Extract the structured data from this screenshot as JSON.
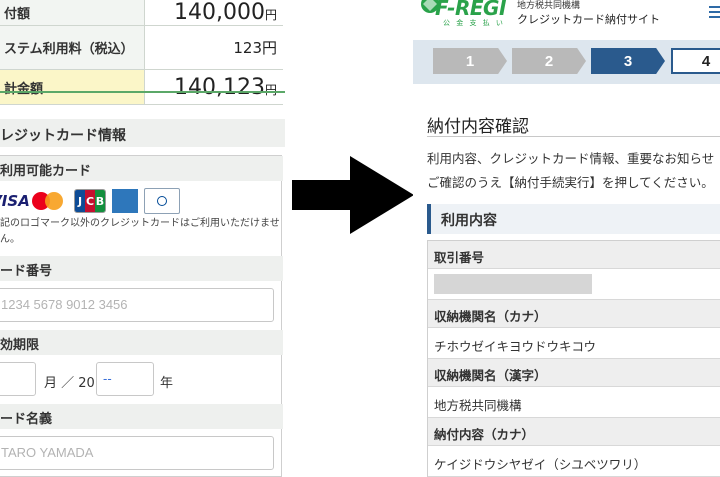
{
  "left": {
    "amounts": [
      {
        "label": "付額",
        "value": "140,000",
        "unit": "円"
      },
      {
        "label": "ステム利用料（税込）",
        "value": "123円",
        "unit": ""
      },
      {
        "label": "計金額",
        "value": "140,123",
        "unit": "円"
      }
    ],
    "cc_title": "レジットカード情報",
    "cards_label": "利用可能カード",
    "card_logos": [
      "VISA",
      "mastercard",
      "JCB",
      "AMERICAN EXPRESS",
      "Diners Club INTERNATIONAL"
    ],
    "card_note": "記のロゴマーク以外のクレジットカードはご利用いただけません。",
    "card_number_label": "ード番号",
    "card_number_placeholder": "1234 5678 9012 3456",
    "expiry_label": "効期限",
    "expiry_month_suffix": "月 ／ 20",
    "expiry_year_value": "--",
    "expiry_year_suffix": "年",
    "name_label": "ード名義",
    "name_placeholder": "TARO YAMADA"
  },
  "arrow_icon": "right-arrow-icon",
  "right": {
    "logo_text": "F-REGI",
    "logo_sub": "公 金 支 払 い",
    "org_name": "地方税共同機構",
    "site_name": "クレジットカード納付サイト",
    "steps": [
      "1",
      "2",
      "3",
      "4"
    ],
    "active_step": "3",
    "page_title": "納付内容確認",
    "intro_line1": "利用内容、クレジットカード情報、重要なお知らせ",
    "intro_line2": "ご確認のうえ【納付手続実行】を押してください。",
    "section_title": "利用内容",
    "details": [
      {
        "label": "取引番号",
        "value": ""
      },
      {
        "label": "収納機関名（カナ）",
        "value": "チホウゼイキヨウドウキコウ"
      },
      {
        "label": "収納機関名（漢字）",
        "value": "地方税共同機構"
      },
      {
        "label": "納付内容（カナ）",
        "value": "ケイジドウシヤゼイ（シユベツワリ）"
      }
    ]
  },
  "colors": {
    "green_accent": "#5ba868",
    "total_bg": "#fbf6c8",
    "step_active": "#2a5a8d",
    "step_inactive": "#b9b9b9",
    "logo_green": "#2aa24a"
  }
}
